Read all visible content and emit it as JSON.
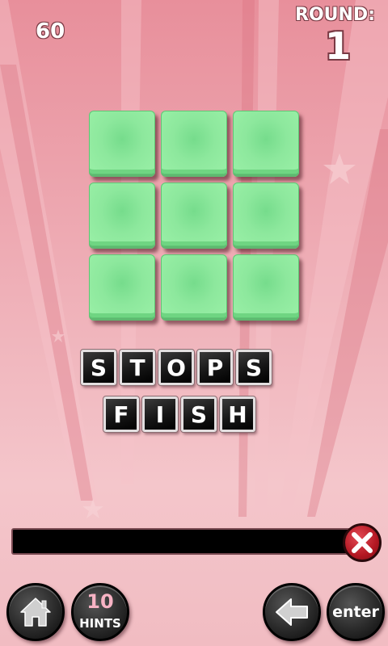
{
  "header": {
    "score": "60",
    "round_label": "ROUND:",
    "round_number": "1"
  },
  "board": {
    "tiles": [
      "",
      "",
      "",
      "",
      "",
      "",
      "",
      "",
      ""
    ],
    "tile_color": "#8de89d"
  },
  "words": [
    {
      "letters": [
        "S",
        "T",
        "O",
        "P",
        "S"
      ]
    },
    {
      "letters": [
        "F",
        "I",
        "S",
        "H"
      ]
    }
  ],
  "answer": {
    "value": ""
  },
  "controls": {
    "home_icon": "home-icon",
    "hints_count": "10",
    "hints_label": "HINTS",
    "back_icon": "back-arrow-icon",
    "enter_label": "enter",
    "clear_icon": "clear-x-icon"
  },
  "colors": {
    "background": "#efb0b8",
    "accent_red": "#b31722",
    "tile_green": "#8de89d"
  }
}
